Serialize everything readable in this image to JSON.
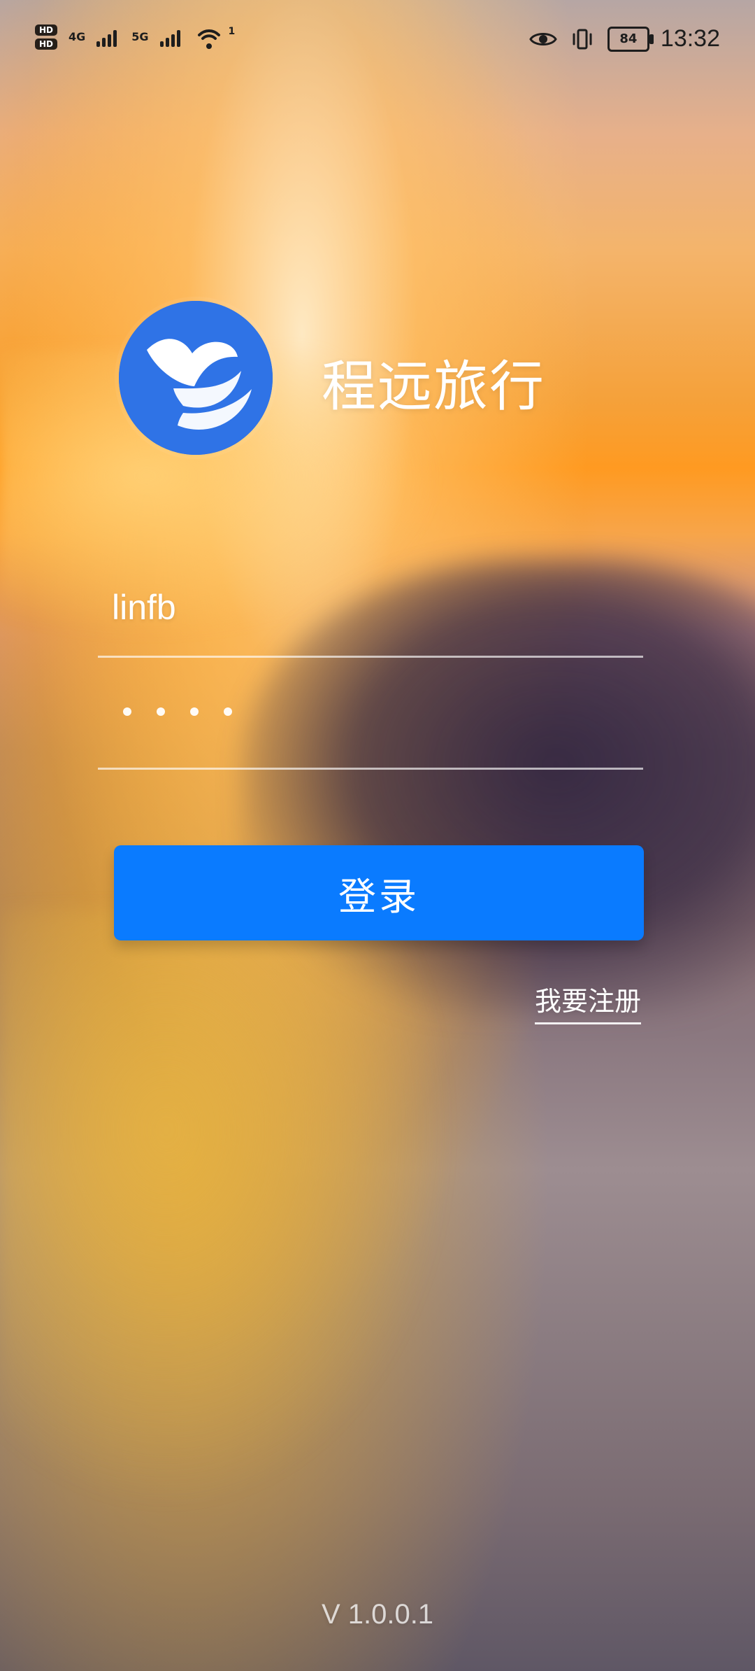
{
  "status_bar": {
    "hd_1": "HD",
    "hd_2": "HD",
    "net_4g": "4G",
    "net_5g": "5G",
    "wifi_badge": "1",
    "battery": "84",
    "time": "13:32",
    "icons": {
      "eye": "eye-icon",
      "vibrate": "vibrate-icon",
      "wifi": "wifi-icon",
      "signal": "signal-icon"
    }
  },
  "app": {
    "title": "程远旅行",
    "logo": "bird-logo-icon",
    "brand_color": "#2f73e6"
  },
  "login_form": {
    "username_value": "linfb",
    "password_masked": "••••",
    "login_button": "登录",
    "register_link": "我要注册"
  },
  "footer": {
    "version": "V 1.0.0.1"
  },
  "colors": {
    "primary_button": "#0a7bff"
  }
}
